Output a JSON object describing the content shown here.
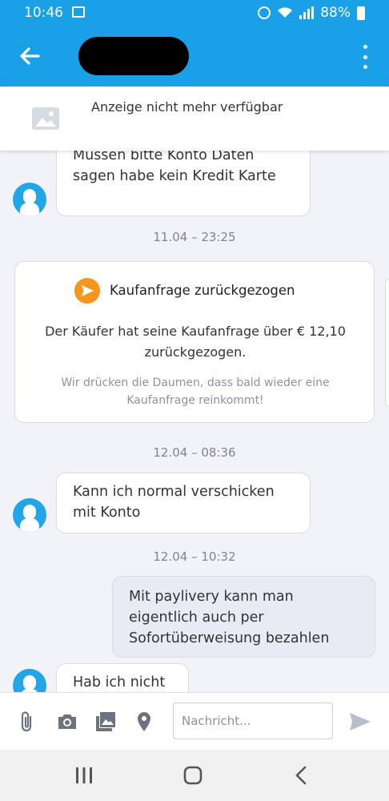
{
  "status_bar": {
    "time": "10:46",
    "battery": "88%"
  },
  "ad_banner": {
    "text": "Anzeige nicht mehr verfügbar"
  },
  "messages": [
    {
      "type": "incoming",
      "text": "Müssen bitte Konto Daten sagen habe kein Kredit Karte"
    },
    {
      "type": "timestamp",
      "text": "11.04 – 23:25"
    },
    {
      "type": "system",
      "title": "Kaufanfrage zurückgezogen",
      "text": "Der Käufer hat seine Kaufanfrage über € 12,10 zurückgezogen.",
      "subtext": "Wir drücken die Daumen, dass bald wieder eine Kaufanfrage reinkommt!"
    },
    {
      "type": "timestamp",
      "text": "12.04 – 08:36"
    },
    {
      "type": "incoming",
      "text": "Kann ich normal verschicken mit Konto"
    },
    {
      "type": "timestamp",
      "text": "12.04 – 10:32"
    },
    {
      "type": "outgoing",
      "text": "Mit paylivery kann man eigentlich auch per Sofortüberweisung bezahlen"
    },
    {
      "type": "incoming",
      "text": "Hab ich nicht"
    }
  ],
  "input": {
    "placeholder": "Nachricht..."
  },
  "icons": {
    "attach": "paperclip-icon",
    "camera": "camera-icon",
    "gallery": "gallery-icon",
    "location": "location-pin-icon",
    "send": "send-icon"
  },
  "colors": {
    "primary": "#1aa0e6",
    "accent": "#f7961c"
  }
}
